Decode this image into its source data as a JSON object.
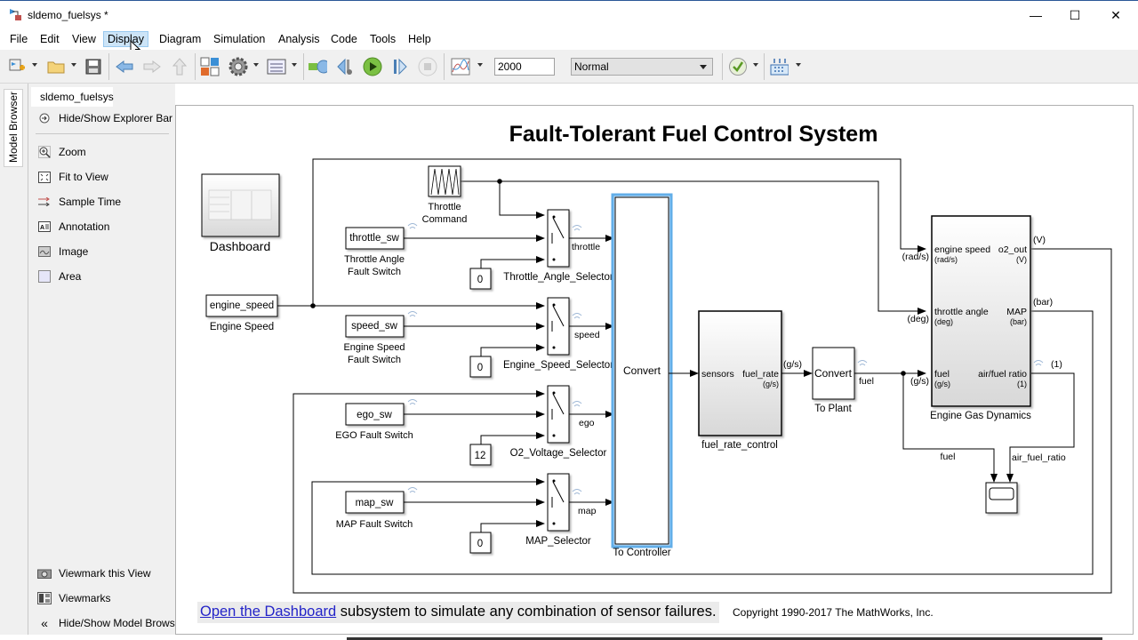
{
  "window": {
    "title": "sldemo_fuelsys *",
    "controls": {
      "minimize": "—",
      "maximize": "☐",
      "close": "✕"
    }
  },
  "menubar": {
    "items": [
      "File",
      "Edit",
      "View",
      "Display",
      "Diagram",
      "Simulation",
      "Analysis",
      "Code",
      "Tools",
      "Help"
    ],
    "active": "Display"
  },
  "toolbar": {
    "stop_time": "2000",
    "sim_mode": "Normal",
    "icons": [
      "new-model-icon",
      "open-folder-icon",
      "save-icon",
      "back-icon",
      "forward-icon",
      "up-icon",
      "library-browser-icon",
      "model-config-icon",
      "model-explorer-icon",
      "update-diagram-icon",
      "step-back-icon",
      "run-icon",
      "step-forward-icon",
      "stop-icon",
      "data-inspector-icon",
      "model-advisor-icon",
      "build-icon"
    ]
  },
  "sidebar": {
    "vertical_tab": "Model Browser",
    "model_tab": "sldemo_fuelsys",
    "items": [
      "Hide/Show Explorer Bar",
      "Zoom",
      "Fit to View",
      "Sample Time",
      "Annotation",
      "Image",
      "Area"
    ],
    "bottom_items": [
      "Viewmark this View",
      "Viewmarks",
      "Hide/Show Model Browser"
    ]
  },
  "diagram": {
    "title": "Fault-Tolerant Fuel Control System",
    "blocks": {
      "dashboard": "Dashboard",
      "throttle_command": [
        "Throttle",
        "Command"
      ],
      "throttle_sw": "throttle_sw",
      "throttle_sw_label": [
        "Throttle Angle",
        "Fault Switch"
      ],
      "engine_speed": "engine_speed",
      "engine_speed_label": "Engine Speed",
      "speed_sw": "speed_sw",
      "speed_sw_label": [
        "Engine Speed",
        "Fault Switch"
      ],
      "ego_sw": "ego_sw",
      "ego_sw_label": "EGO Fault Switch",
      "map_sw": "map_sw",
      "map_sw_label": "MAP Fault Switch",
      "const_throttle": "0",
      "const_speed": "0",
      "const_ego": "12",
      "const_map": "0",
      "sel_throttle": "Throttle_Angle_Selector",
      "sel_speed": "Engine_Speed_Selector",
      "sel_ego": "O2_Voltage_Selector",
      "sel_map": "MAP_Selector",
      "sig_throttle": "throttle",
      "sig_speed": "speed",
      "sig_ego": "ego",
      "sig_map": "map",
      "to_controller_text": "Convert",
      "to_controller_label": "To Controller",
      "frc_in": "sensors",
      "frc_out": "fuel_rate",
      "frc_out_unit": "(g/s)",
      "frc_label": "fuel_rate_control",
      "frc_line_unit": "(g/s)",
      "to_plant_text": "Convert",
      "to_plant_label": "To Plant",
      "sig_fuel": "fuel",
      "egd_label": "Engine Gas Dynamics",
      "egd_in": [
        [
          "engine speed",
          "(rad/s)"
        ],
        [
          "throttle angle",
          "(deg)"
        ],
        [
          "fuel",
          "(g/s)"
        ]
      ],
      "egd_out": [
        [
          "o2_out",
          "(V)"
        ],
        [
          "MAP",
          "(bar)"
        ],
        [
          "air/fuel ratio",
          "(1)"
        ]
      ],
      "egd_in_line_units": [
        "(rad/s)",
        "(deg)",
        "(g/s)"
      ],
      "egd_out_line_units": [
        "(V)",
        "(bar)",
        "(1)"
      ],
      "scope_sig_fuel": "fuel",
      "scope_sig_afr": "air_fuel_ratio"
    }
  },
  "footer": {
    "link": "Open the Dashboard",
    "note": " subsystem to simulate any combination of sensor failures.",
    "copyright": "Copyright 1990-2017 The MathWorks, Inc."
  }
}
